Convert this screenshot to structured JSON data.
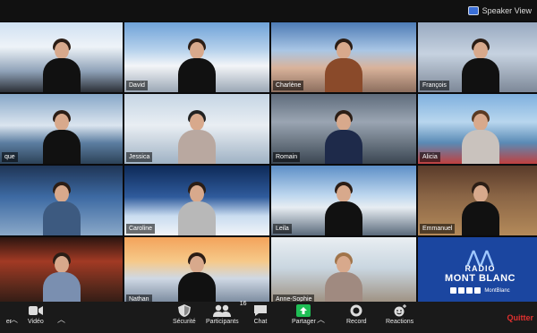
{
  "topbar": {
    "speaker_view_label": "Speaker View"
  },
  "tiles": [
    {
      "name": "",
      "bg": "bg-studio"
    },
    {
      "name": "David",
      "bg": "bg-alpine"
    },
    {
      "name": "Charlène",
      "bg": "bg-peaks"
    },
    {
      "name": "François",
      "bg": "bg-grey"
    },
    {
      "name": "que",
      "bg": "bg-lake"
    },
    {
      "name": "Jessica",
      "bg": "bg-snowforest"
    },
    {
      "name": "Romain",
      "bg": "bg-office"
    },
    {
      "name": "Alicia",
      "bg": "bg-harbor"
    },
    {
      "name": "",
      "bg": "bg-stadium"
    },
    {
      "name": "Caroline",
      "bg": "bg-night"
    },
    {
      "name": "Leila",
      "bg": "bg-valley"
    },
    {
      "name": "Emmanuel",
      "bg": "bg-chalet"
    },
    {
      "name": "",
      "bg": "bg-crowd"
    },
    {
      "name": "Nathan",
      "bg": "bg-sunset"
    },
    {
      "name": "Anne-Sophie",
      "bg": "bg-winterwin"
    }
  ],
  "radio_tile": {
    "line1": "RADIO",
    "line2": "MONT BLANC",
    "handle": "MontBlanc"
  },
  "toolbar": {
    "left_cut_label": "er",
    "video_label": "Vidéo",
    "security_label": "Sécurité",
    "participants_label": "Participants",
    "participants_count": "16",
    "chat_label": "Chat",
    "share_label": "Partager",
    "record_label": "Record",
    "reactions_label": "Reactions",
    "end_label": "Quitter"
  },
  "colors": {
    "share_green": "#1fbe55",
    "end_red": "#e0302f"
  }
}
